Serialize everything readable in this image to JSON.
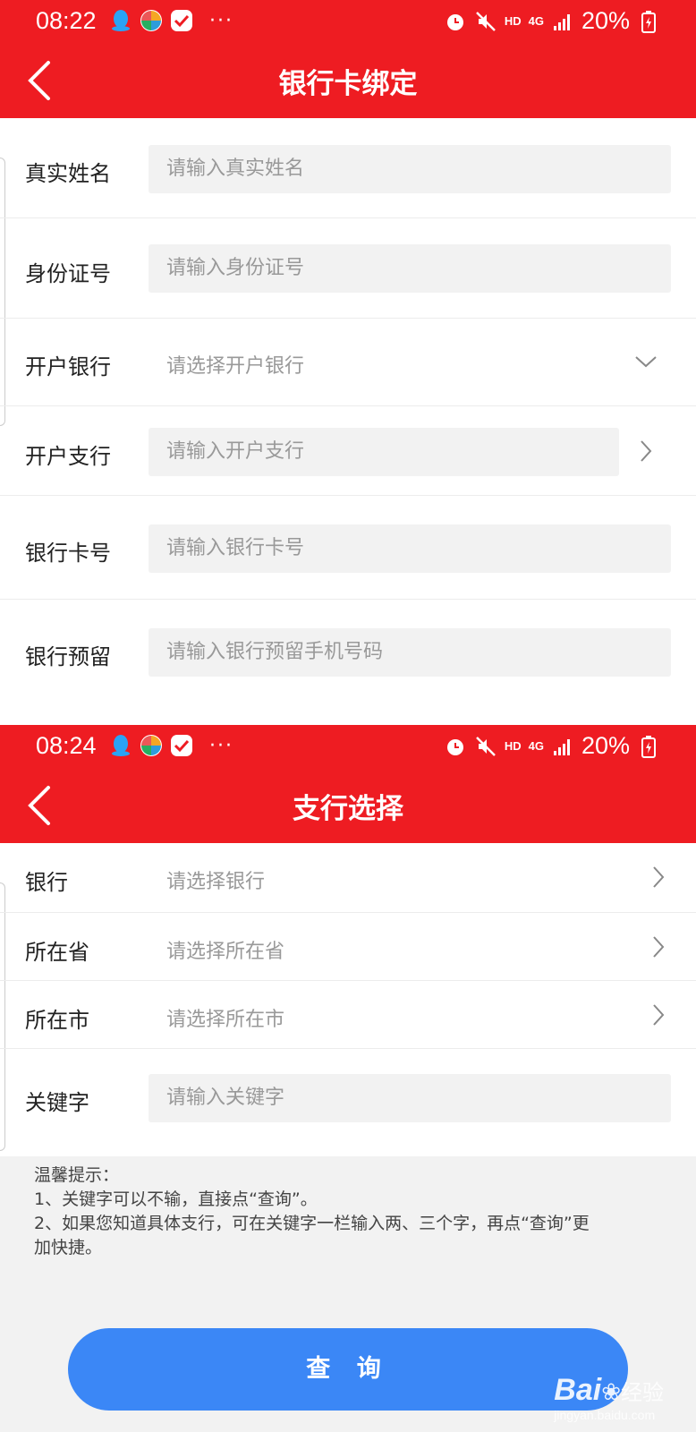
{
  "screen1": {
    "status": {
      "time": "08:22",
      "battery": "20%",
      "hd": "HD",
      "network": "4G"
    },
    "nav": {
      "title": "银行卡绑定"
    },
    "form": {
      "real_name": {
        "label": "真实姓名",
        "placeholder": "请输入真实姓名"
      },
      "id_number": {
        "label": "身份证号",
        "placeholder": "请输入身份证号"
      },
      "bank": {
        "label": "开户银行",
        "placeholder": "请选择开户银行"
      },
      "branch": {
        "label": "开户支行",
        "placeholder": "请输入开户支行"
      },
      "card_number": {
        "label": "银行卡号",
        "placeholder": "请输入银行卡号"
      },
      "reserved_phone": {
        "label": "银行预留",
        "placeholder": "请输入银行预留手机号码"
      }
    }
  },
  "screen2": {
    "status": {
      "time": "08:24",
      "battery": "20%",
      "hd": "HD",
      "network": "4G"
    },
    "nav": {
      "title": "支行选择"
    },
    "form": {
      "bank": {
        "label": "银行",
        "placeholder": "请选择银行"
      },
      "province": {
        "label": "所在省",
        "placeholder": "请选择所在省"
      },
      "city": {
        "label": "所在市",
        "placeholder": "请选择所在市"
      },
      "keyword": {
        "label": "关键字",
        "placeholder": "请输入关键字"
      }
    },
    "hint": {
      "title": "温馨提示：",
      "line1": "1、关键字可以不输，直接点“查询”。",
      "line2a": "2、如果您知道具体支行，可在关键字一栏输入两、三个字，再点“查询”更",
      "line2b": "加快捷。"
    },
    "query_button": "查 询"
  },
  "watermark": {
    "brand": "Bai",
    "brand2": "经验",
    "url": "jingyan.baidu.com"
  },
  "colors": {
    "header_red": "#ee1c22",
    "button_blue": "#3b87f6",
    "input_bg": "#f2f2f2",
    "placeholder": "#999999"
  }
}
